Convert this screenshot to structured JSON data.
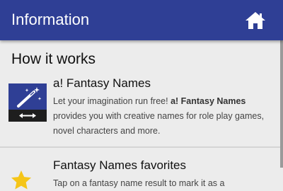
{
  "appbar": {
    "title": "Information",
    "home_icon": "home-icon"
  },
  "section": {
    "title": "How it works"
  },
  "items": [
    {
      "title": "a! Fantasy Names",
      "icon": "magic-wand-icon",
      "desc_before": "Let your imagination run free! ",
      "desc_bold": "a! Fantasy Names",
      "desc_after": " provides you with creative names for role play games, novel characters and more."
    },
    {
      "title": "Fantasy Names favorites",
      "icon": "star-icon",
      "desc": "Tap on a fantasy name result to mark it as a"
    }
  ],
  "colors": {
    "appbar": "#2f3f95",
    "star": "#f5c518",
    "background": "#ececec"
  }
}
